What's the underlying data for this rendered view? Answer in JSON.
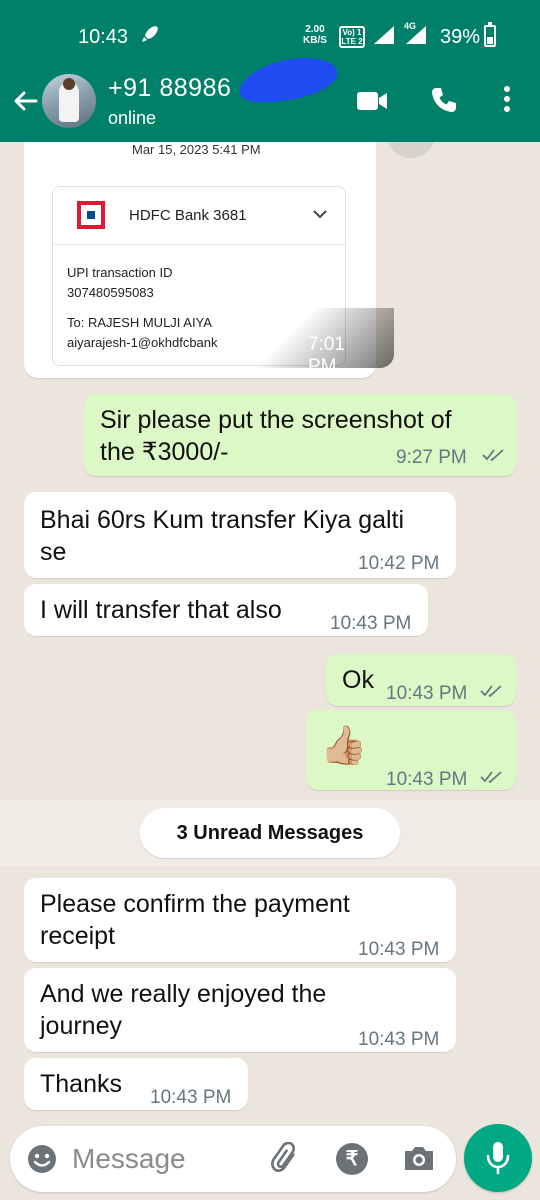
{
  "status_bar": {
    "time": "10:43",
    "net_speed": "2.00",
    "net_unit": "KB/S",
    "volte_top": "Vo) 1",
    "volte_bottom": "LTE 2",
    "network": "4G",
    "battery": "39%"
  },
  "header": {
    "contact_name": "+91 88986",
    "contact_status": "online"
  },
  "payment_card": {
    "date": "Mar 15, 2023 5:41 PM",
    "bank": "HDFC Bank 3681",
    "upi_label": "UPI transaction ID",
    "upi_id": "307480595083",
    "to": "To: RAJESH MULJI AIYA",
    "upi_handle": "aiyarajesh-1@okhdfcbank",
    "time": "7:01 PM"
  },
  "messages": [
    {
      "direction": "out",
      "line1": "Sir please put the screenshot of",
      "line2": "the ₹3000/-",
      "time": "9:27 PM",
      "read": true
    },
    {
      "direction": "in",
      "line1": "Bhai 60rs Kum transfer Kiya galti",
      "line2": "se",
      "time": "10:42 PM"
    },
    {
      "direction": "in",
      "line1": "I will transfer that also",
      "time": "10:43 PM"
    },
    {
      "direction": "out",
      "line1": "Ok",
      "time": "10:43 PM",
      "read": true
    },
    {
      "direction": "out",
      "line1": "👍🏼",
      "time": "10:43 PM",
      "read": true
    },
    {
      "direction": "in",
      "line1": "Please confirm the payment",
      "line2": "receipt",
      "time": "10:43 PM"
    },
    {
      "direction": "in",
      "line1": "And we really enjoyed the",
      "line2": "journey",
      "time": "10:43 PM"
    },
    {
      "direction": "in",
      "line1": "Thanks",
      "time": "10:43 PM"
    }
  ],
  "unread_banner": "3 Unread Messages",
  "input": {
    "placeholder": "Message"
  },
  "colors": {
    "header": "#008069",
    "outgoing_bubble": "#dcf8c6",
    "incoming_bubble": "#ffffff",
    "chat_bg": "#ece5dd",
    "mic_button": "#00a884",
    "read_ticks": "#667781"
  },
  "icons": {
    "back": "arrow-left",
    "video_call": "video-camera",
    "voice_call": "phone",
    "menu": "three-dots-vertical",
    "emoji": "smiley",
    "attach": "paperclip",
    "payment": "rupee-circle",
    "camera": "camera",
    "mic": "microphone"
  }
}
